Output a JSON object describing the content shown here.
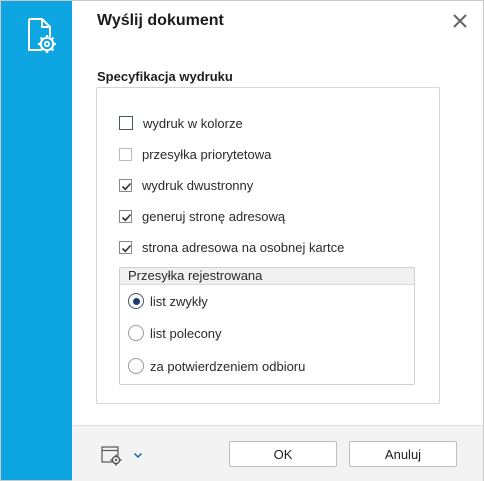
{
  "dialog": {
    "title": "Wyślij dokument"
  },
  "print_spec": {
    "title": "Specyfikacja wydruku",
    "checkboxes": [
      {
        "label": "wydruk w kolorze",
        "checked": false,
        "enabled": true,
        "focused": true
      },
      {
        "label": "przesyłka priorytetowa",
        "checked": false,
        "enabled": false
      },
      {
        "label": "wydruk dwustronny",
        "checked": true,
        "enabled": true
      },
      {
        "label": "generuj stronę adresową",
        "checked": true,
        "enabled": true
      },
      {
        "label": "strona adresowa na osobnej kartce",
        "checked": true,
        "enabled": true
      }
    ],
    "registered": {
      "title": "Przesyłka rejestrowana",
      "options": [
        {
          "label": "list zwykły",
          "selected": true
        },
        {
          "label": "list polecony",
          "selected": false
        },
        {
          "label": "za potwierdzeniem odbioru",
          "selected": false
        }
      ]
    }
  },
  "footer": {
    "ok_label": "OK",
    "cancel_label": "Anuluj"
  },
  "colors": {
    "sidebar": "#0ea5e3",
    "radio_dot": "#1a3c6b"
  },
  "icons": {
    "sidebar": "document-gear-icon",
    "close": "close-icon",
    "footer": "window-settings-icon",
    "dropdown": "chevron-down-icon"
  }
}
